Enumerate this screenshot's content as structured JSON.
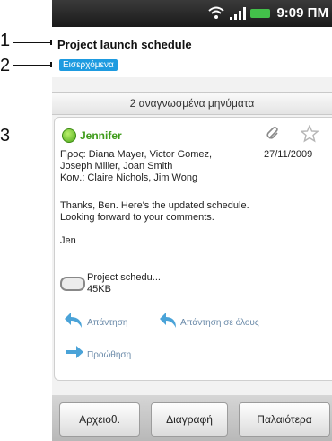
{
  "callouts": [
    "1",
    "2",
    "3"
  ],
  "status_bar": {
    "time": "9:09 ΠΜ"
  },
  "header": {
    "subject": "Project launch schedule",
    "label": "Εισερχόμενα"
  },
  "read_count": "2 αναγνωσμένα μηνύματα",
  "message": {
    "sender": "Jennifer",
    "to": "Προς: Diana Mayer, Victor Gomez,",
    "to_cont": "Joseph Miller, Joan Smith",
    "date": "27/11/2009",
    "cc": "Κοιν.: Claire Nichols, Jim Wong",
    "body": "Thanks, Ben. Here's the updated schedule.\nLooking forward to your comments.\n\nJen",
    "attachment": {
      "name": "Project schedu...",
      "size": "45KB"
    },
    "actions": {
      "reply": "Απάντηση",
      "reply_all": "Απάντηση σε όλους",
      "forward": "Προώθηση"
    }
  },
  "bottom_bar": {
    "archive": "Αρχειοθ.",
    "delete": "Διαγραφή",
    "older": "Παλαιότερα"
  },
  "colors": {
    "label_badge": "#1e9be0",
    "sender": "#3e9b1a",
    "action_text": "#6a8aa9",
    "battery": "#43c04a"
  },
  "icons": [
    "wifi-icon",
    "signal-icon",
    "battery-icon",
    "status-dot-icon",
    "paperclip-icon",
    "star-icon",
    "attachment-icon",
    "reply-icon",
    "reply-all-icon",
    "forward-icon"
  ]
}
